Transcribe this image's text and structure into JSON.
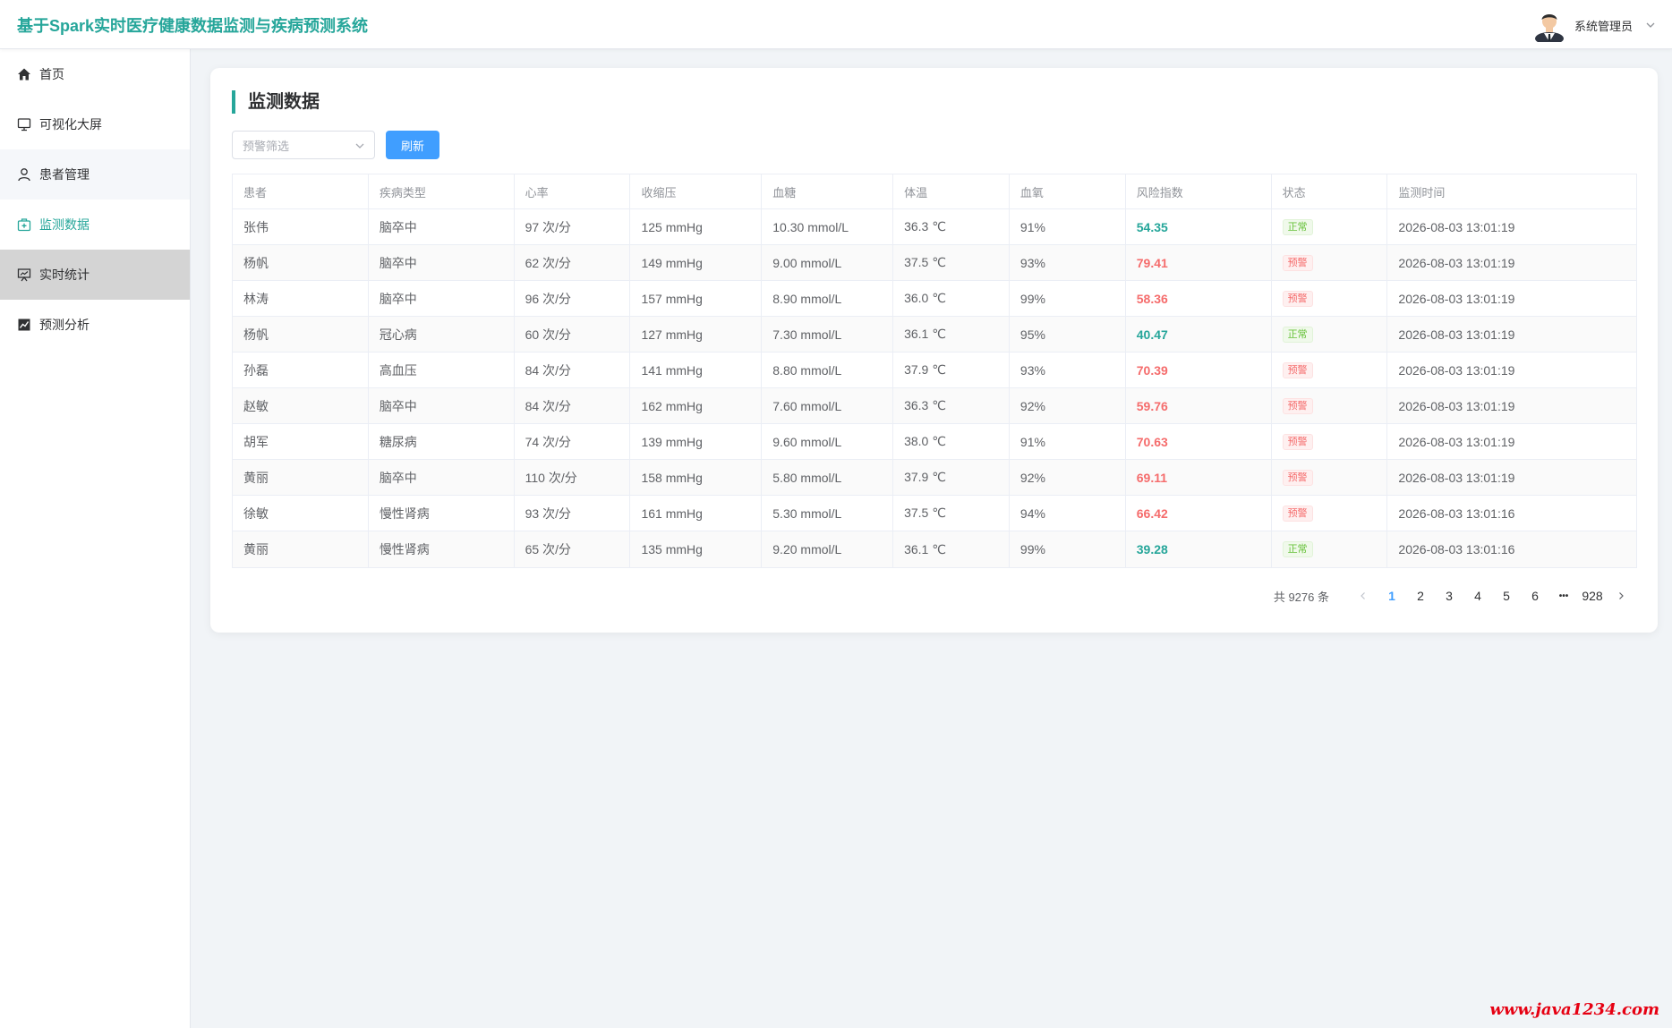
{
  "header": {
    "title": "基于Spark实时医疗健康数据监测与疾病预测系统",
    "user_name": "系统管理员",
    "avatar_icon": "user-avatar"
  },
  "sidebar": {
    "items": [
      {
        "label": "首页",
        "icon": "home-icon"
      },
      {
        "label": "可视化大屏",
        "icon": "monitor-icon"
      },
      {
        "label": "患者管理",
        "icon": "user-icon"
      },
      {
        "label": "监测数据",
        "icon": "medical-box-icon"
      },
      {
        "label": "实时统计",
        "icon": "presentation-chart-icon"
      },
      {
        "label": "预测分析",
        "icon": "trend-chart-icon"
      }
    ],
    "active_item": "监测数据"
  },
  "main": {
    "title": "监测数据",
    "filter_placeholder": "预警筛选",
    "refresh_label": "刷新",
    "columns": [
      "患者",
      "疾病类型",
      "心率",
      "收缩压",
      "血糖",
      "体温",
      "血氧",
      "风险指数",
      "状态",
      "监测时间"
    ],
    "rows": [
      {
        "patient": "张伟",
        "disease": "脑卒中",
        "heart_rate": "97 次/分",
        "systolic": "125 mmHg",
        "glucose": "10.30 mmol/L",
        "temp": "36.3 ℃",
        "spo2": "91%",
        "risk": "54.35",
        "status": "正常",
        "time": "2026-08-03 13:01:19"
      },
      {
        "patient": "杨帆",
        "disease": "脑卒中",
        "heart_rate": "62 次/分",
        "systolic": "149 mmHg",
        "glucose": "9.00 mmol/L",
        "temp": "37.5 ℃",
        "spo2": "93%",
        "risk": "79.41",
        "status": "预警",
        "time": "2026-08-03 13:01:19"
      },
      {
        "patient": "林涛",
        "disease": "脑卒中",
        "heart_rate": "96 次/分",
        "systolic": "157 mmHg",
        "glucose": "8.90 mmol/L",
        "temp": "36.0 ℃",
        "spo2": "99%",
        "risk": "58.36",
        "status": "预警",
        "time": "2026-08-03 13:01:19"
      },
      {
        "patient": "杨帆",
        "disease": "冠心病",
        "heart_rate": "60 次/分",
        "systolic": "127 mmHg",
        "glucose": "7.30 mmol/L",
        "temp": "36.1 ℃",
        "spo2": "95%",
        "risk": "40.47",
        "status": "正常",
        "time": "2026-08-03 13:01:19"
      },
      {
        "patient": "孙磊",
        "disease": "高血压",
        "heart_rate": "84 次/分",
        "systolic": "141 mmHg",
        "glucose": "8.80 mmol/L",
        "temp": "37.9 ℃",
        "spo2": "93%",
        "risk": "70.39",
        "status": "预警",
        "time": "2026-08-03 13:01:19"
      },
      {
        "patient": "赵敏",
        "disease": "脑卒中",
        "heart_rate": "84 次/分",
        "systolic": "162 mmHg",
        "glucose": "7.60 mmol/L",
        "temp": "36.3 ℃",
        "spo2": "92%",
        "risk": "59.76",
        "status": "预警",
        "time": "2026-08-03 13:01:19"
      },
      {
        "patient": "胡军",
        "disease": "糖尿病",
        "heart_rate": "74 次/分",
        "systolic": "139 mmHg",
        "glucose": "9.60 mmol/L",
        "temp": "38.0 ℃",
        "spo2": "91%",
        "risk": "70.63",
        "status": "预警",
        "time": "2026-08-03 13:01:19"
      },
      {
        "patient": "黄丽",
        "disease": "脑卒中",
        "heart_rate": "110 次/分",
        "systolic": "158 mmHg",
        "glucose": "5.80 mmol/L",
        "temp": "37.9 ℃",
        "spo2": "92%",
        "risk": "69.11",
        "status": "预警",
        "time": "2026-08-03 13:01:19"
      },
      {
        "patient": "徐敏",
        "disease": "慢性肾病",
        "heart_rate": "93 次/分",
        "systolic": "161 mmHg",
        "glucose": "5.30 mmol/L",
        "temp": "37.5 ℃",
        "spo2": "94%",
        "risk": "66.42",
        "status": "预警",
        "time": "2026-08-03 13:01:16"
      },
      {
        "patient": "黄丽",
        "disease": "慢性肾病",
        "heart_rate": "65 次/分",
        "systolic": "135 mmHg",
        "glucose": "9.20 mmol/L",
        "temp": "36.1 ℃",
        "spo2": "99%",
        "risk": "39.28",
        "status": "正常",
        "time": "2026-08-03 13:01:16"
      }
    ]
  },
  "pagination": {
    "total_label": "共 9276 条",
    "pages": [
      "1",
      "2",
      "3",
      "4",
      "5",
      "6"
    ],
    "ellipsis": "•••",
    "last_page": "928",
    "current_page": "1"
  },
  "watermark": "www.java1234.com",
  "colors": {
    "brand": "#26a69a",
    "primary": "#409eff",
    "danger": "#f56c6c",
    "success": "#67c23a"
  }
}
